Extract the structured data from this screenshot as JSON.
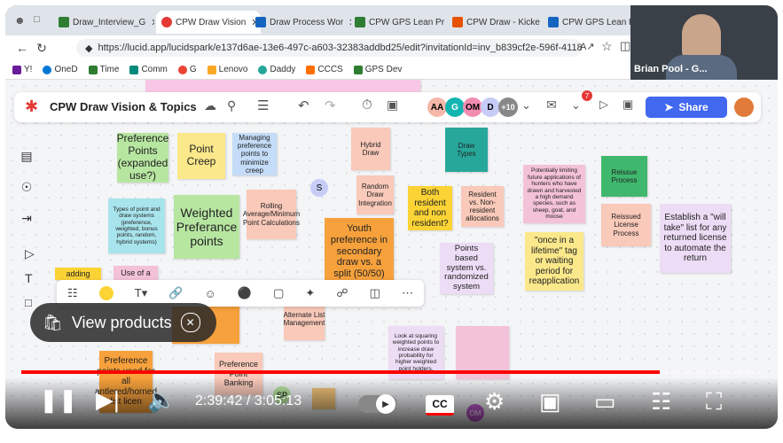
{
  "browser": {
    "tabs": [
      {
        "label": "Draw_Interview_G",
        "color": "#2e7d32"
      },
      {
        "label": "CPW Draw Vision",
        "color": "#e53935",
        "active": true
      },
      {
        "label": "Draw Process Wor",
        "color": "#1565c0"
      },
      {
        "label": "CPW GPS Lean Pr",
        "color": "#2e7d32"
      },
      {
        "label": "CPW Draw - Kicke",
        "color": "#e65100"
      },
      {
        "label": "CPW GPS Lean Pr",
        "color": "#1565c0"
      }
    ],
    "url": "https://lucid.app/lucidspark/e137d6ae-13e6-497c-a603-32383addbd25/edit?invitationId=inv_b839cf2e-596f-4118-a167-816...",
    "bookmarks": [
      "Y!",
      "OneD",
      "Time",
      "Comm",
      "G",
      "G",
      "Lenovo",
      "Daddy",
      "CCCS",
      "GPS Dev"
    ]
  },
  "webcam": {
    "name": "Brian Pool - G..."
  },
  "lucid": {
    "title": "CPW Draw Vision & Topics",
    "avatars": [
      "AA",
      "G",
      "OM",
      "D",
      "+10"
    ],
    "notif_count": "7",
    "share_label": "Share"
  },
  "notes": {
    "pref_points": "Preference Points (expanded use?)",
    "point_creep": "Point Creep",
    "managing": "Managing preference points to minimize creep",
    "hybrid": "Hybrid Draw",
    "draw_types": "Draw Types",
    "limiting": "Potentially limiting future applications of hunters who have drawn and harvested a high demand species, such as sheep, goat, and moose",
    "reissue": "Reissue Process",
    "types": "Types of point and draw systems (preference, weighted, bonus points, random, hybrid systems)",
    "weighted": "Weighted Preferance points",
    "rolling": "Rolling Average/Minimum Point Calculations",
    "random": "Random Draw Integration",
    "both": "Both resident and non resident?",
    "res_vs": "Resident vs. Non-resident allocations",
    "reissued": "Reissued License Process",
    "will_take": "Establish a \"will take\" list for any returned license to automate the return",
    "youth": "Youth preference in secondary draw vs. a split (50/50)",
    "points_based": "Points based system vs. randomized system",
    "once": "\"once in a lifetime\" tag or waiting period for reapplication",
    "alternate": "Alternate List Management",
    "squaring": "Look at squaring weighted points to increase draw probability for higher weighted point holders.",
    "pref_used": "Preference points used for all antlered/horned list licen",
    "pref_banking": "Preference Point Banking",
    "use_of": "Use of a",
    "adding": "adding"
  },
  "video": {
    "view_products": "View products",
    "time": "2:39:42 / 3:05:13",
    "progress": 0.862
  }
}
